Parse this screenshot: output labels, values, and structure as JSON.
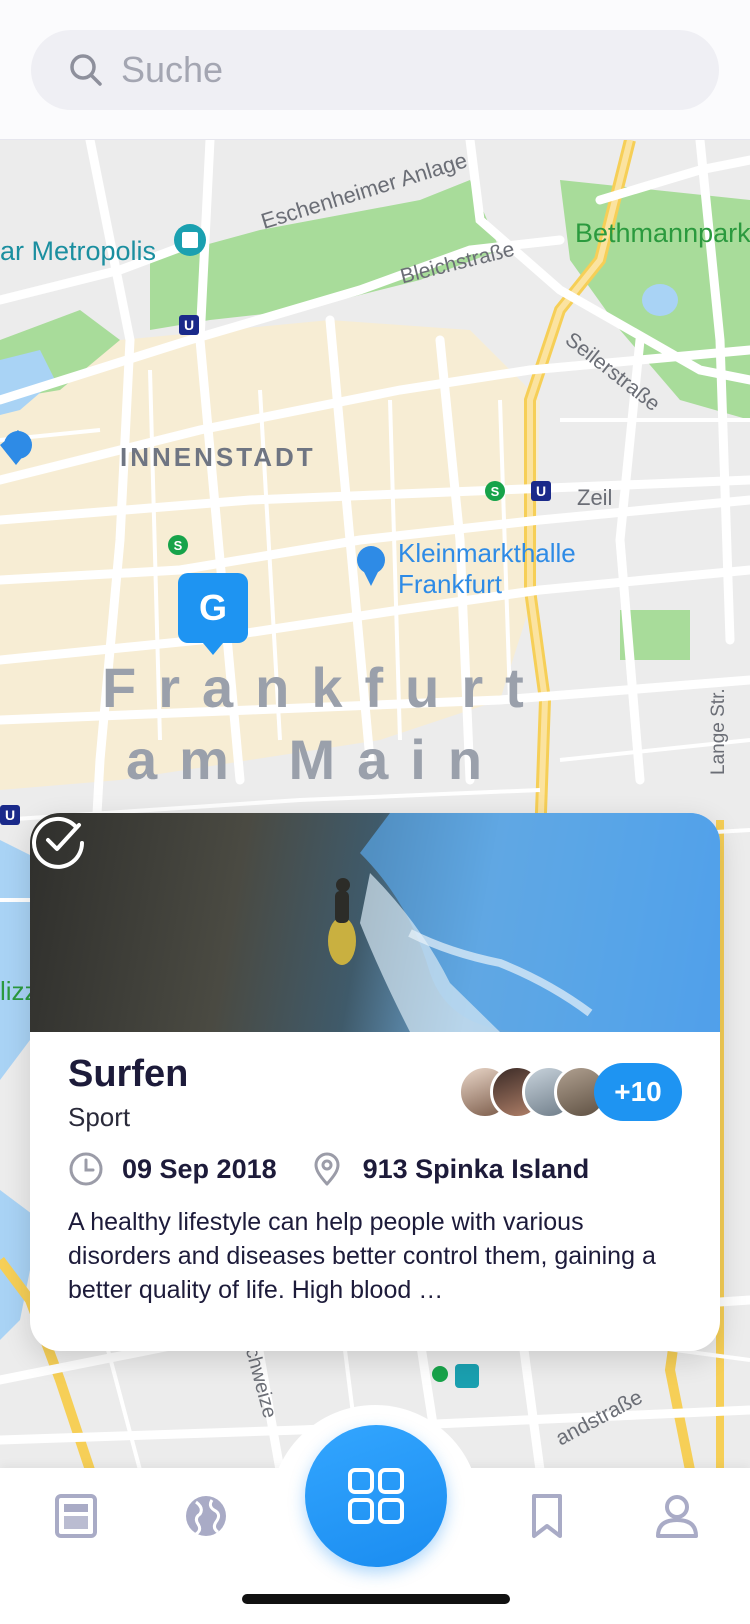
{
  "search": {
    "placeholder": "Suche"
  },
  "map": {
    "labels": {
      "metropolis": "ar Metropolis",
      "eschenheimer": "Eschenheimer Anlage",
      "bethmannpark": "Bethmannpark",
      "bleichstrasse": "Bleichstraße",
      "seilerstrasse": "Seilerstraße",
      "innenstadt": "INNENSTADT",
      "zeil": "Zeil",
      "kleinmarkthalle_line1": "Kleinmarkthalle",
      "kleinmarkthalle_line2": "Frankfurt",
      "city_line1": "Frankfurt",
      "city_line2": "am Main",
      "lange_str": "Lange Str.",
      "schweizer": "chweize",
      "landstrasse": "andstraße",
      "lizz": "lizz"
    },
    "marker_letter": "G",
    "u_badge": "U",
    "s_badge": "S"
  },
  "event_card": {
    "title": "Surfen",
    "category": "Sport",
    "date": "09 Sep 2018",
    "location": "913 Spinka Island",
    "description": "A healthy lifestyle can help people with various disorders and diseases better control them, gaining a better quality of life. High blood …",
    "attendees_more": "+10",
    "accent_color": "#1e94f2"
  },
  "bottom_nav": {
    "items": [
      "news-icon",
      "globe-icon",
      "grid-icon",
      "bookmark-icon",
      "profile-icon"
    ]
  }
}
